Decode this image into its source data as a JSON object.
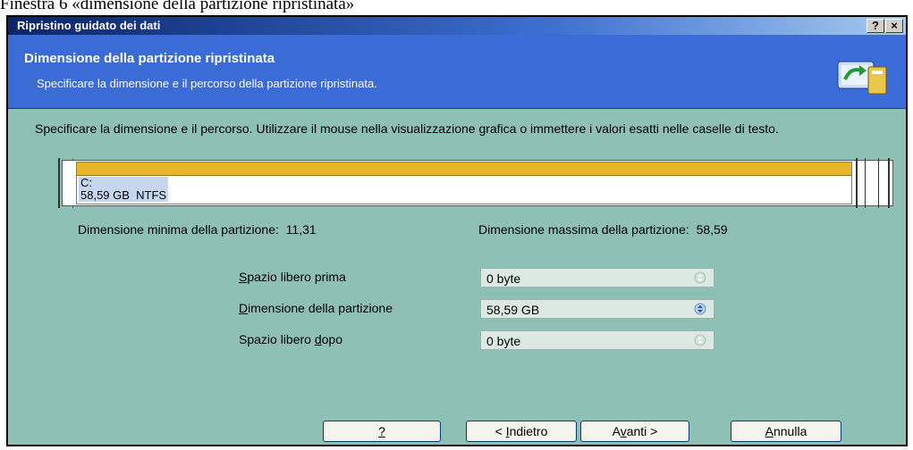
{
  "caption": "Finestra  6 «dimensione della partizione ripristinata»",
  "window": {
    "title": "Ripristino guidato dei dati",
    "help_label": "?",
    "close_label": "×"
  },
  "header": {
    "title": "Dimensione della partizione ripristinata",
    "subtitle": "Specificare la dimensione e il percorso della partizione ripristinata.",
    "icon": "restore-wizard-icon"
  },
  "description": "Specificare la dimensione e il percorso. Utilizzare il mouse nella visualizzazione grafica o immettere i valori esatti nelle caselle di testo.",
  "partition": {
    "drive": "C:",
    "info": "58,59 GB  NTFS",
    "bar_color": "#e8b62a"
  },
  "limits": {
    "min_label": "Dimensione minima della partizione:",
    "min_value": "11,31",
    "max_label": "Dimensione massima della partizione:",
    "max_value": "58,59"
  },
  "fields": {
    "free_before": {
      "label_key": "S",
      "label_rest": "pazio libero prima",
      "value": "0 byte"
    },
    "partition_size": {
      "label_key": "D",
      "label_rest": "imensione della partizione",
      "value": "58,59 GB"
    },
    "free_after": {
      "label_pre": "Spazio libero ",
      "label_key": "d",
      "label_rest": "opo",
      "value": "0 byte"
    }
  },
  "buttons": {
    "help": "?",
    "back_pre": "< ",
    "back_key": "I",
    "back_rest": "ndietro",
    "next_pre": "A",
    "next_key": "v",
    "next_rest": "anti >",
    "cancel_key": "A",
    "cancel_rest": "nnulla"
  },
  "colors": {
    "window_bg": "#8fc0b5",
    "header_bg": "#3a6bd6"
  }
}
